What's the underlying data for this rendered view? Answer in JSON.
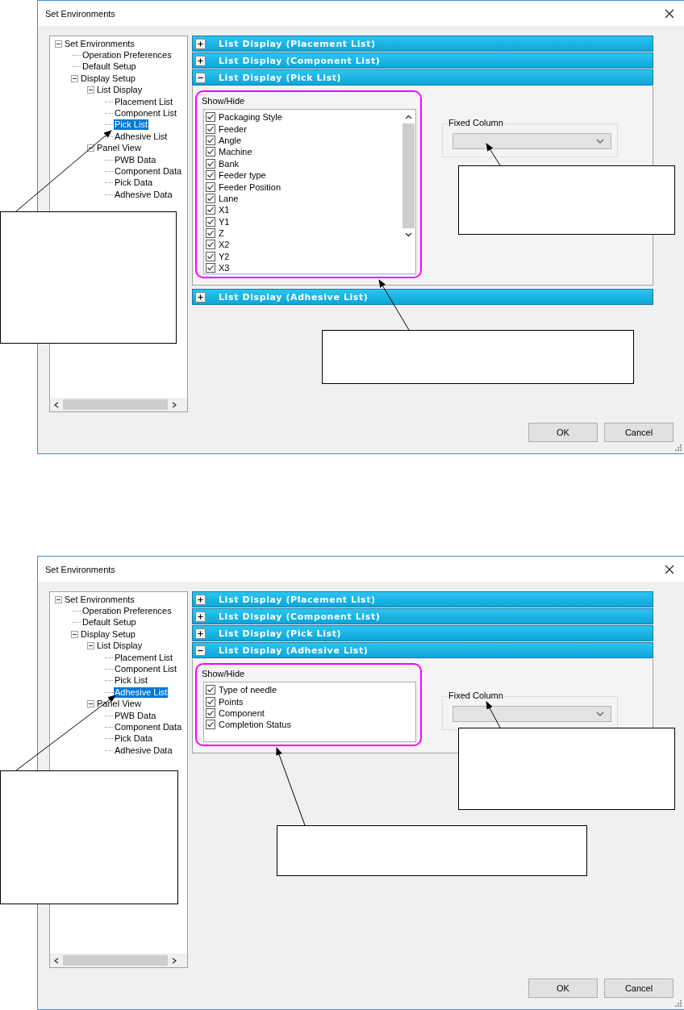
{
  "dialogs": [
    {
      "title": "Set Environments",
      "tree": [
        {
          "label": "Set Environments",
          "selected": false,
          "expanded": true,
          "children": [
            {
              "label": "Operation Preferences",
              "selected": false
            },
            {
              "label": "Default Setup",
              "selected": false
            },
            {
              "label": "Display Setup",
              "selected": false,
              "expanded": true,
              "children": [
                {
                  "label": "List Display",
                  "selected": false,
                  "expanded": true,
                  "children": [
                    {
                      "label": "Placement List",
                      "selected": false
                    },
                    {
                      "label": "Component List",
                      "selected": false
                    },
                    {
                      "label": "Pick List",
                      "selected": true
                    },
                    {
                      "label": "Adhesive List",
                      "selected": false
                    }
                  ]
                },
                {
                  "label": "Panel View",
                  "selected": false,
                  "expanded": true,
                  "children": [
                    {
                      "label": "PWB Data",
                      "selected": false
                    },
                    {
                      "label": "Component Data",
                      "selected": false
                    },
                    {
                      "label": "Pick Data",
                      "selected": false
                    },
                    {
                      "label": "Adhesive Data",
                      "selected": false
                    }
                  ]
                }
              ]
            }
          ]
        }
      ],
      "sections": [
        {
          "title": "List Display (Placement List)",
          "expanded": false
        },
        {
          "title": "List Display (Component List)",
          "expanded": false
        },
        {
          "title": "List Display (Pick List)",
          "expanded": true,
          "show_hide_label": "Show/Hide",
          "fixed_column_label": "Fixed Column",
          "items": [
            {
              "label": "Packaging Style",
              "checked": true
            },
            {
              "label": "Feeder",
              "checked": true
            },
            {
              "label": "Angle",
              "checked": true
            },
            {
              "label": "Machine",
              "checked": true
            },
            {
              "label": "Bank",
              "checked": true
            },
            {
              "label": "Feeder type",
              "checked": true
            },
            {
              "label": "Feeder Position",
              "checked": true
            },
            {
              "label": "Lane",
              "checked": true
            },
            {
              "label": "X1",
              "checked": true
            },
            {
              "label": "Y1",
              "checked": true
            },
            {
              "label": "Z",
              "checked": true
            },
            {
              "label": "X2",
              "checked": true
            },
            {
              "label": "Y2",
              "checked": true
            },
            {
              "label": "X3",
              "checked": true
            }
          ]
        },
        {
          "title": "List Display (Adhesive List)",
          "expanded": false
        }
      ],
      "buttons": [
        "OK",
        "Cancel"
      ]
    },
    {
      "title": "Set Environments",
      "tree": [
        {
          "label": "Set Environments",
          "selected": false,
          "expanded": true,
          "children": [
            {
              "label": "Operation Preferences",
              "selected": false
            },
            {
              "label": "Default Setup",
              "selected": false
            },
            {
              "label": "Display Setup",
              "selected": false,
              "expanded": true,
              "children": [
                {
                  "label": "List Display",
                  "selected": false,
                  "expanded": true,
                  "children": [
                    {
                      "label": "Placement List",
                      "selected": false
                    },
                    {
                      "label": "Component List",
                      "selected": false
                    },
                    {
                      "label": "Pick List",
                      "selected": false
                    },
                    {
                      "label": "Adhesive List",
                      "selected": true
                    }
                  ]
                },
                {
                  "label": "Panel View",
                  "selected": false,
                  "expanded": true,
                  "children": [
                    {
                      "label": "PWB Data",
                      "selected": false
                    },
                    {
                      "label": "Component Data",
                      "selected": false
                    },
                    {
                      "label": "Pick Data",
                      "selected": false
                    },
                    {
                      "label": "Adhesive Data",
                      "selected": false
                    }
                  ]
                }
              ]
            }
          ]
        }
      ],
      "sections": [
        {
          "title": "List Display (Placement List)",
          "expanded": false
        },
        {
          "title": "List Display (Component List)",
          "expanded": false
        },
        {
          "title": "List Display (Pick List)",
          "expanded": false
        },
        {
          "title": "List Display (Adhesive List)",
          "expanded": true,
          "show_hide_label": "Show/Hide",
          "fixed_column_label": "Fixed Column",
          "items": [
            {
              "label": "Type of needle",
              "checked": true
            },
            {
              "label": "Points",
              "checked": true
            },
            {
              "label": "Component",
              "checked": true
            },
            {
              "label": "Completion Status",
              "checked": true
            }
          ]
        }
      ],
      "buttons": [
        "OK",
        "Cancel"
      ]
    }
  ]
}
